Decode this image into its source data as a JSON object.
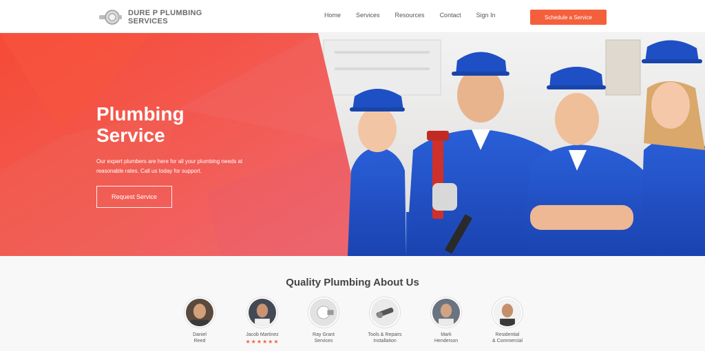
{
  "header": {
    "logo": {
      "line1": "DURE P PLUMBING",
      "line2": "SERVICES"
    },
    "nav": [
      "Home",
      "Services",
      "Resources",
      "Contact",
      "Sign In"
    ],
    "cta_label": "Schedule a Service"
  },
  "hero": {
    "title_line1": "Plumbing",
    "title_line2": "Service",
    "subtitle_line1": "Our expert plumbers are here for all your plumbing needs at",
    "subtitle_line2": "reasonable rates. Call us today for support.",
    "button_label": "Request Service"
  },
  "team": {
    "title": "Quality Plumbing About Us",
    "members": [
      {
        "name1": "Daniel",
        "name2": "Reed",
        "stars": ""
      },
      {
        "name1": "Jacob Martinez",
        "name2": "",
        "stars": "★★★★★★"
      },
      {
        "name1": "Ray Grant",
        "name2": "Services",
        "stars": ""
      },
      {
        "name1": "Tools & Repairs",
        "name2": "Installation",
        "stars": ""
      },
      {
        "name1": "Mark",
        "name2": "Henderson",
        "stars": ""
      },
      {
        "name1": "Residential",
        "name2": "& Commercial",
        "stars": ""
      }
    ]
  },
  "colors": {
    "accent": "#f4603c",
    "hero_coral": "#f2604d",
    "uniform_blue": "#1f4fc4"
  }
}
